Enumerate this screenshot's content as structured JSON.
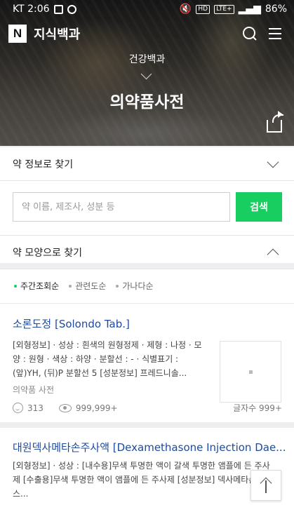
{
  "status_bar": {
    "carrier_time": "KT 2:06",
    "network": "LTE+",
    "hd": "HD",
    "battery": "86%"
  },
  "app": {
    "logo": "N",
    "title": "지식백과"
  },
  "hero": {
    "subtitle": "건강백과",
    "title": "의약품사전"
  },
  "find_info": {
    "label": "약 정보로 찾기"
  },
  "search": {
    "placeholder": "약 이름, 제조사, 성분 등",
    "button": "검색"
  },
  "find_shape": {
    "label": "약 모양으로 찾기"
  },
  "sort": {
    "items": [
      {
        "label": "주간조회순",
        "active": true
      },
      {
        "label": "관련도순",
        "active": false
      },
      {
        "label": "가나다순",
        "active": false
      }
    ]
  },
  "results": [
    {
      "title": "소론도정 [Solondo Tab.]",
      "description": "[외형정보] · 성상 : 흰색의 원형정제 · 제형 : 나정 · 모양 : 원형 · 색상 : 하양 · 분할선 : - · 식별표기 : (앞)YH, (뒤)P 분할선 5 [성분정보] 프레드니솔...",
      "source": "의약품 사전",
      "likes": "313",
      "views": "999,999+",
      "char_count": "글자수 999+"
    },
    {
      "title": "대원덱사메타손주사액 [Dexamethasone Injection Dae...",
      "description": "[외형정보] · 성상 : [내수용]무색 투명한 액이 갈색 투명한 앰플에 든 주사제 [수출용]무색 투명한 액이 앰플에 든 주사제 [성분정보] 덱사메타손포스..."
    }
  ]
}
